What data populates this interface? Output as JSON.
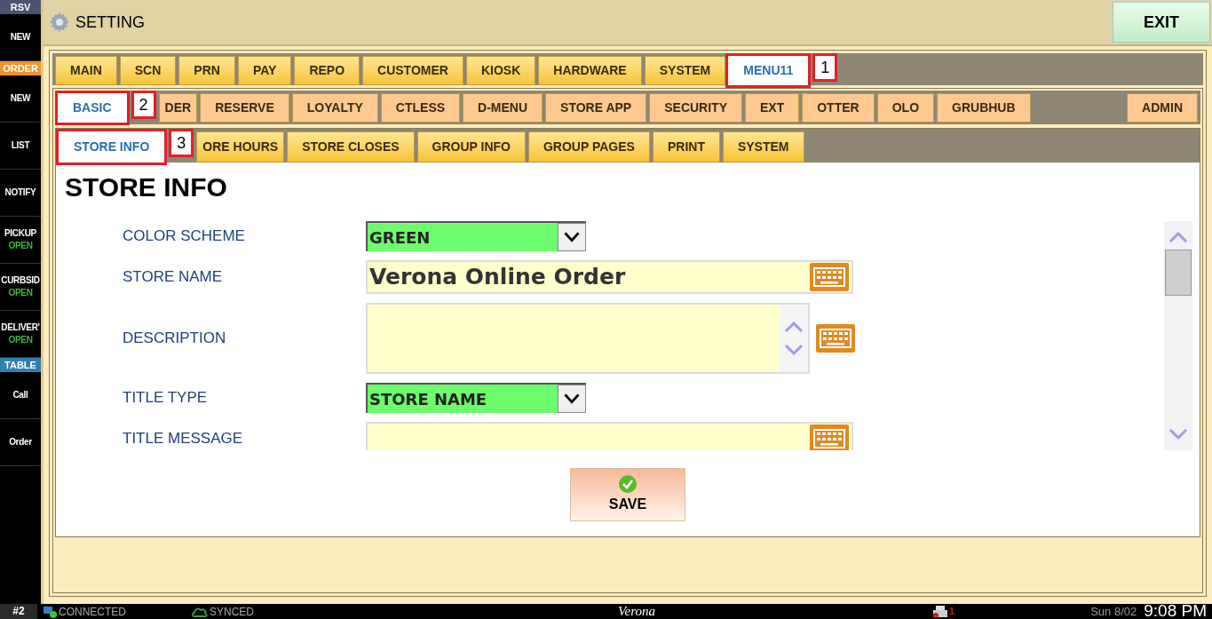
{
  "sidebar": [
    {
      "kind": "header",
      "label": "RSV",
      "color": "#4a5470"
    },
    {
      "kind": "button",
      "label": "NEW"
    },
    {
      "kind": "header",
      "label": "ORDER",
      "color": "#f0952e"
    },
    {
      "kind": "button",
      "label": "NEW"
    },
    {
      "kind": "button",
      "label": "LIST"
    },
    {
      "kind": "button",
      "label": "NOTIFY"
    },
    {
      "kind": "button",
      "label": "PICKUP",
      "status": "OPEN"
    },
    {
      "kind": "button",
      "label": "CURBSID",
      "status": "OPEN"
    },
    {
      "kind": "button",
      "label": "DELIVER'",
      "status": "OPEN"
    },
    {
      "kind": "header",
      "label": "TABLE",
      "color": "#2f7fb0"
    },
    {
      "kind": "button",
      "label": "Call"
    },
    {
      "kind": "button",
      "label": "Order"
    }
  ],
  "header": {
    "title": "SETTING",
    "exit": "EXIT"
  },
  "tabs": [
    {
      "label": "MAIN",
      "selected": false
    },
    {
      "label": "SCN",
      "selected": false
    },
    {
      "label": "PRN",
      "selected": false
    },
    {
      "label": "PAY",
      "selected": false
    },
    {
      "label": "REPO",
      "selected": false
    },
    {
      "label": "CUSTOMER",
      "selected": false
    },
    {
      "label": "KIOSK",
      "selected": false
    },
    {
      "label": "HARDWARE",
      "selected": false
    },
    {
      "label": "SYSTEM",
      "selected": false
    },
    {
      "label": "MENU11",
      "selected": true,
      "callout": "1"
    }
  ],
  "subtabs": [
    {
      "label": "BASIC",
      "selected": true,
      "callout": "2"
    },
    {
      "label": "DER",
      "selected": false
    },
    {
      "label": "RESERVE",
      "selected": false
    },
    {
      "label": "LOYALTY",
      "selected": false
    },
    {
      "label": "CTLESS",
      "selected": false
    },
    {
      "label": "D-MENU",
      "selected": false
    },
    {
      "label": "STORE APP",
      "selected": false
    },
    {
      "label": "SECURITY",
      "selected": false
    },
    {
      "label": "EXT",
      "selected": false
    },
    {
      "label": "OTTER",
      "selected": false
    },
    {
      "label": "OLO",
      "selected": false
    },
    {
      "label": "GRUBHUB",
      "selected": false
    }
  ],
  "admin_tab": {
    "label": "ADMIN",
    "selected": false
  },
  "section_tabs": [
    {
      "label": "STORE INFO",
      "selected": true,
      "callout": "3"
    },
    {
      "label": "ORE HOURS",
      "selected": false
    },
    {
      "label": "STORE CLOSES",
      "selected": false
    },
    {
      "label": "GROUP INFO",
      "selected": false
    },
    {
      "label": "GROUP PAGES",
      "selected": false
    },
    {
      "label": "PRINT",
      "selected": false
    },
    {
      "label": "SYSTEM",
      "selected": false
    }
  ],
  "page_title": "STORE INFO",
  "fields": [
    {
      "kind": "select",
      "label": "COLOR SCHEME",
      "value": "GREEN"
    },
    {
      "kind": "text",
      "label": "STORE NAME",
      "value": "Verona Online Order"
    },
    {
      "kind": "textarea",
      "label": "DESCRIPTION"
    },
    {
      "kind": "select",
      "label": "TITLE TYPE",
      "value": "STORE NAME"
    },
    {
      "kind": "text",
      "label": "TITLE MESSAGE"
    }
  ],
  "save": "SAVE",
  "status_bar": {
    "station": "#2",
    "connection": "CONNECTED",
    "sync": "SYNCED",
    "brand": "Verona",
    "printer_count": "1",
    "date": "Sun 8/02",
    "time": "9:08 PM"
  }
}
